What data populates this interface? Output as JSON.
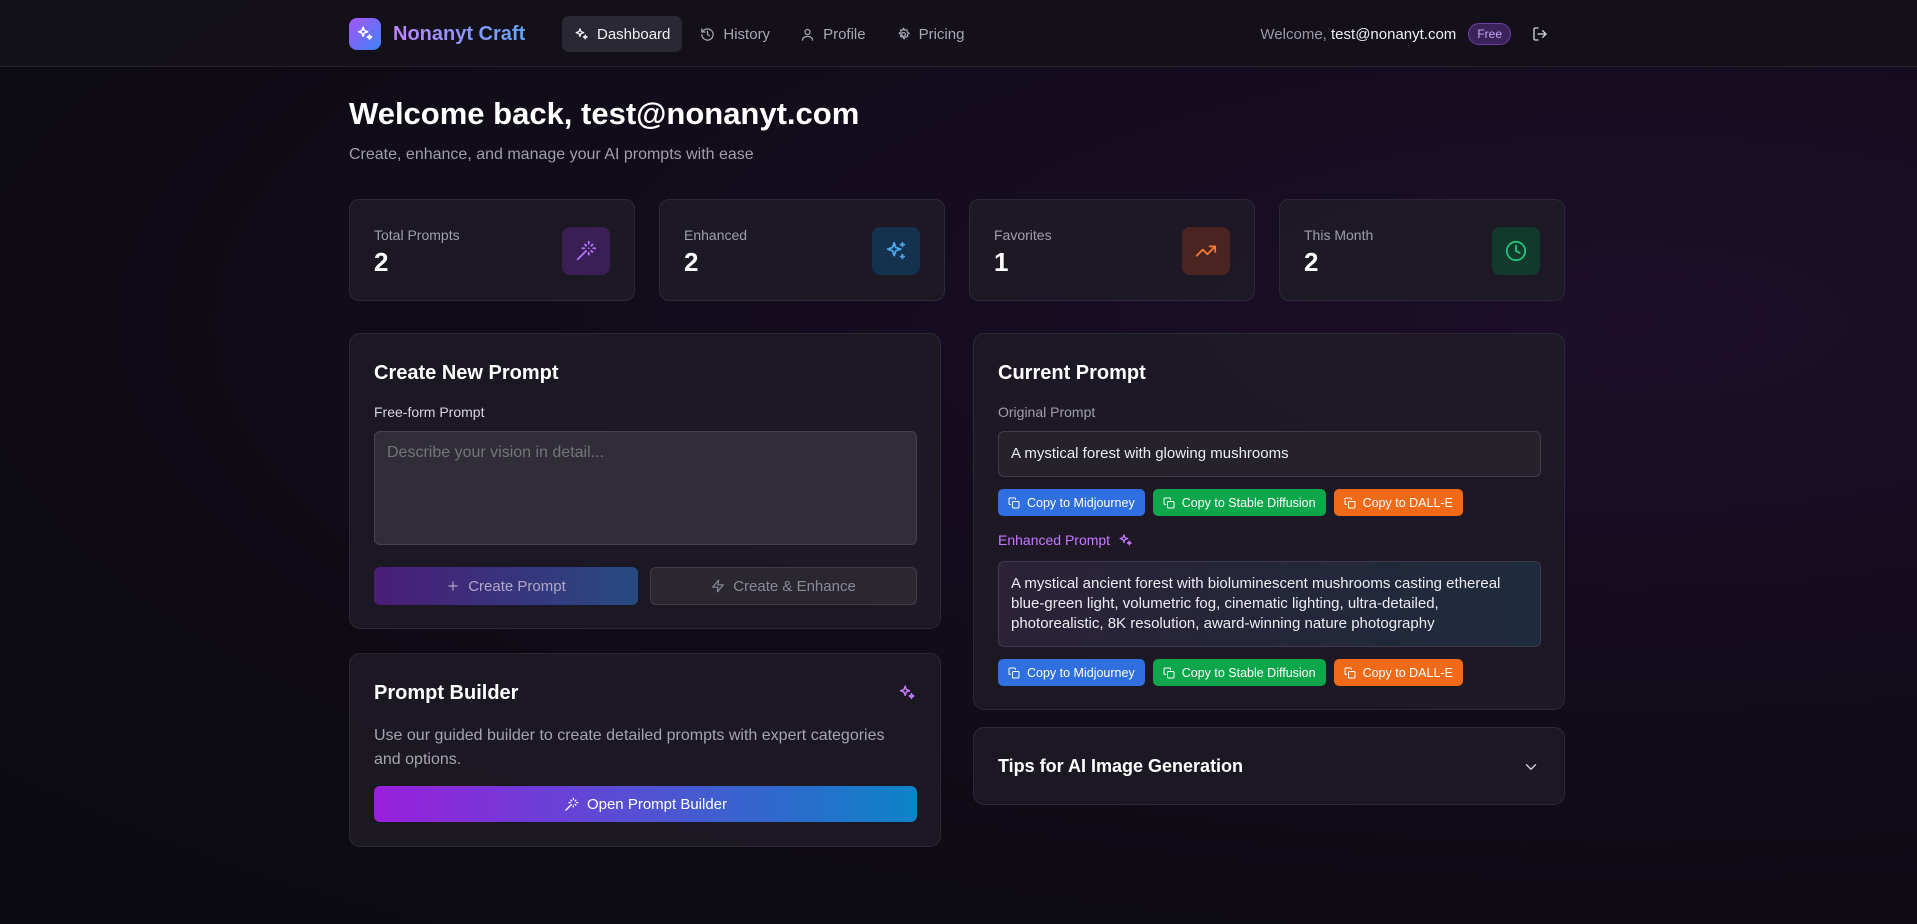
{
  "header": {
    "brand_name": "Nonanyt Craft",
    "nav": [
      {
        "label": "Dashboard",
        "icon": "sparkles-icon",
        "active": true
      },
      {
        "label": "History",
        "icon": "history-icon"
      },
      {
        "label": "Profile",
        "icon": "user-icon"
      },
      {
        "label": "Pricing",
        "icon": "gear-icon"
      }
    ],
    "welcome_prefix": "Welcome,",
    "user_email": "test@nonanyt.com",
    "plan_badge": "Free"
  },
  "welcome": {
    "title": "Welcome back, test@nonanyt.com",
    "subtitle": "Create, enhance, and manage your AI prompts with ease"
  },
  "stats": [
    {
      "label": "Total Prompts",
      "value": "2",
      "icon": "wand-icon",
      "color": "#b675ff",
      "bg": "#3a1f55"
    },
    {
      "label": "Enhanced",
      "value": "2",
      "icon": "sparkles-icon",
      "color": "#4aa8f0",
      "bg": "#14314d"
    },
    {
      "label": "Favorites",
      "value": "1",
      "icon": "trending-up-icon",
      "color": "#f07a3a",
      "bg": "#4a2420"
    },
    {
      "label": "This Month",
      "value": "2",
      "icon": "clock-icon",
      "color": "#22c47a",
      "bg": "#123a2c"
    }
  ],
  "create_panel": {
    "title": "Create New Prompt",
    "field_label": "Free-form Prompt",
    "placeholder": "Describe your vision in detail...",
    "create_label": "Create Prompt",
    "enhance_label": "Create & Enhance"
  },
  "builder_panel": {
    "title": "Prompt Builder",
    "description": "Use our guided builder to create detailed prompts with expert categories and options.",
    "button_label": "Open Prompt Builder"
  },
  "current_panel": {
    "title": "Current Prompt",
    "original_label": "Original Prompt",
    "original_text": "A mystical forest with glowing mushrooms",
    "enhanced_label": "Enhanced Prompt",
    "enhanced_text": "A mystical ancient forest with bioluminescent mushrooms casting ethereal blue-green light, volumetric fog, cinematic lighting, ultra-detailed, photorealistic, 8K resolution, award-winning nature photography",
    "copy_buttons": [
      "Copy to Midjourney",
      "Copy to Stable Diffusion",
      "Copy to DALL-E"
    ]
  },
  "tips_panel": {
    "title": "Tips for AI Image Generation"
  }
}
